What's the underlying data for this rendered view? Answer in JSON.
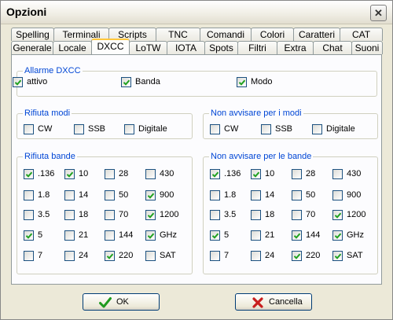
{
  "window": {
    "title": "Opzioni",
    "close_symbol": "✕"
  },
  "tabs_row1": [
    "Spelling",
    "Terminali",
    "Scripts",
    "TNC",
    "Comandi",
    "Colori",
    "Caratteri",
    "CAT"
  ],
  "tabs_row2": [
    "Generale",
    "Locale",
    "DXCC",
    "LoTW",
    "IOTA",
    "Spots",
    "Filtri",
    "Extra",
    "Chat",
    "Suoni"
  ],
  "active_tab": "DXCC",
  "groups": {
    "allarme": {
      "title": "Allarme DXCC",
      "items": [
        {
          "label": "attivo",
          "checked": true
        },
        {
          "label": "Banda",
          "checked": true
        },
        {
          "label": "Modo",
          "checked": true
        }
      ]
    },
    "rifiuta_modi": {
      "title": "Rifiuta modi",
      "items": [
        {
          "label": "CW",
          "checked": false
        },
        {
          "label": "SSB",
          "checked": false
        },
        {
          "label": "Digitale",
          "checked": false
        }
      ]
    },
    "non_avvisare_modi": {
      "title": "Non avvisare per i modi",
      "items": [
        {
          "label": "CW",
          "checked": false
        },
        {
          "label": "SSB",
          "checked": false
        },
        {
          "label": "Digitale",
          "checked": false
        }
      ]
    },
    "rifiuta_bande": {
      "title": "Rifiuta bande",
      "items": [
        {
          "label": ".136",
          "checked": true
        },
        {
          "label": "10",
          "checked": true
        },
        {
          "label": "28",
          "checked": false
        },
        {
          "label": "430",
          "checked": false
        },
        {
          "label": "1.8",
          "checked": false
        },
        {
          "label": "14",
          "checked": false
        },
        {
          "label": "50",
          "checked": false
        },
        {
          "label": "900",
          "checked": true
        },
        {
          "label": "3.5",
          "checked": false
        },
        {
          "label": "18",
          "checked": false
        },
        {
          "label": "70",
          "checked": false
        },
        {
          "label": "1200",
          "checked": true
        },
        {
          "label": "5",
          "checked": true
        },
        {
          "label": "21",
          "checked": false
        },
        {
          "label": "144",
          "checked": false
        },
        {
          "label": "GHz",
          "checked": true
        },
        {
          "label": "7",
          "checked": false
        },
        {
          "label": "24",
          "checked": false
        },
        {
          "label": "220",
          "checked": true
        },
        {
          "label": "SAT",
          "checked": false
        }
      ]
    },
    "non_avvisare_bande": {
      "title": "Non avvisare per le bande",
      "items": [
        {
          "label": ".136",
          "checked": true
        },
        {
          "label": "10",
          "checked": true
        },
        {
          "label": "28",
          "checked": false
        },
        {
          "label": "430",
          "checked": false
        },
        {
          "label": "1.8",
          "checked": false
        },
        {
          "label": "14",
          "checked": false
        },
        {
          "label": "50",
          "checked": false
        },
        {
          "label": "900",
          "checked": false
        },
        {
          "label": "3.5",
          "checked": false
        },
        {
          "label": "18",
          "checked": false
        },
        {
          "label": "70",
          "checked": false
        },
        {
          "label": "1200",
          "checked": true
        },
        {
          "label": "5",
          "checked": true
        },
        {
          "label": "21",
          "checked": false
        },
        {
          "label": "144",
          "checked": true
        },
        {
          "label": "GHz",
          "checked": true
        },
        {
          "label": "7",
          "checked": false
        },
        {
          "label": "24",
          "checked": false
        },
        {
          "label": "220",
          "checked": true
        },
        {
          "label": "SAT",
          "checked": true
        }
      ]
    }
  },
  "buttons": {
    "ok": {
      "label": "OK",
      "icon": "checkmark-icon",
      "color": "#1e9a1e"
    },
    "cancel": {
      "label": "Cancella",
      "icon": "red-x-icon",
      "color": "#c81e1e"
    }
  },
  "colors": {
    "check": "#21a121",
    "group_title": "#0046d5",
    "active_tab_accent": "#ffc73c"
  }
}
